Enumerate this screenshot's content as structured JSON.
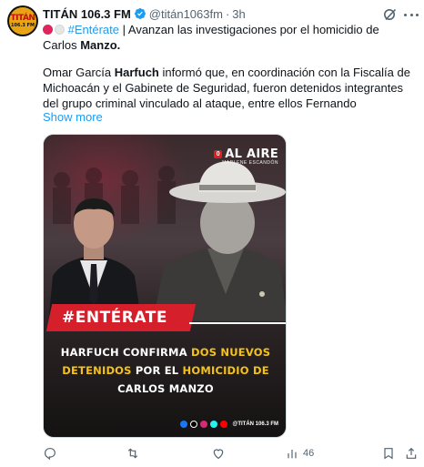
{
  "account": {
    "name": "TITÁN 106.3 FM",
    "handle": "@titán1063fm",
    "separator": "·",
    "time": "3h",
    "avatar_logo_line1": "TITÁN",
    "avatar_logo_line2": "106.3 FM"
  },
  "tweet": {
    "hashtag": "#Entérate",
    "headline_rest": " | Avanzan las investigaciones por el homicidio de Carlos ",
    "headline_bold": "Manzo.",
    "body_part1": "Omar García ",
    "body_bold": "Harfuch",
    "body_part2": " informó que, en coordinación con la Fiscalía de Michoacán y el Gabinete de Seguridad, fueron detenidos integrantes del grupo criminal vinculado al ataque, entre ellos Fernando",
    "show_more": "Show more"
  },
  "media": {
    "live_label": "AL AIRE",
    "live_icon_glyph": "0",
    "host": "MARLENE ESCANDÓN",
    "band_label": "#ENTÉRATE",
    "headline_l1_a": "HARFUCH CONFIRMA ",
    "headline_l1_b": "DOS NUEVOS",
    "headline_l2_a": "DETENIDOS",
    "headline_l2_b": " POR EL ",
    "headline_l2_c": "HOMICIDIO DE",
    "headline_l3": "CARLOS MANZO",
    "footer_handle": "@TITÁN 106.3 FM",
    "colors": {
      "accent_red": "#d51f2a",
      "accent_yellow": "#f4c21b"
    }
  },
  "actions": {
    "views": "46"
  },
  "colors": {
    "link": "#1d9bf0",
    "muted": "#536471",
    "verified": "#1d9bf0"
  }
}
